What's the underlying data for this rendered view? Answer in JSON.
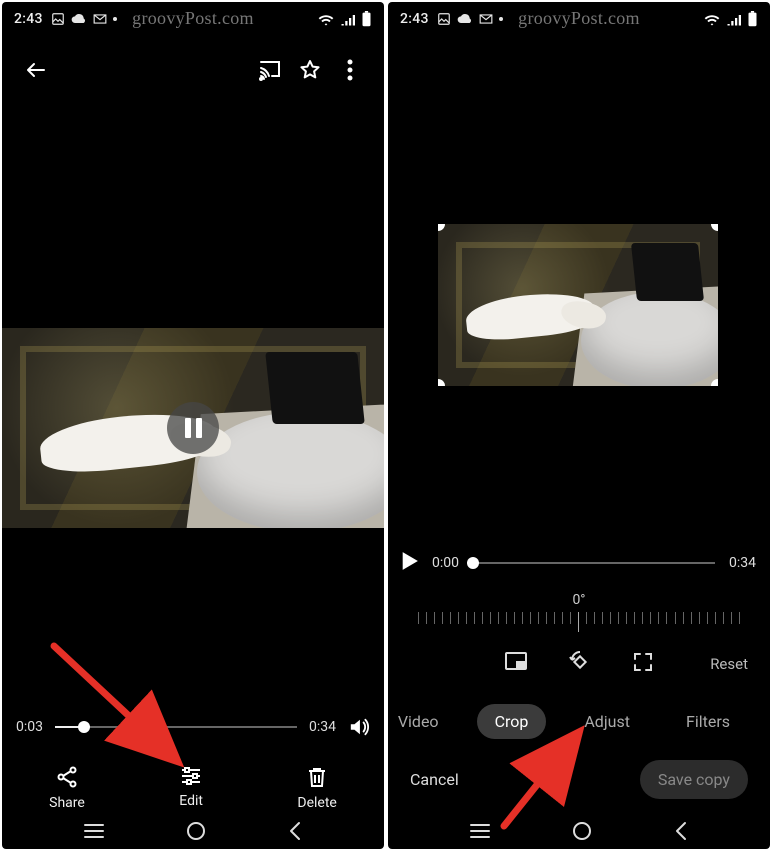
{
  "left": {
    "statusbar": {
      "time": "2:43"
    },
    "watermark": "groovyPost.com",
    "scrubber": {
      "current": "0:03",
      "total": "0:34",
      "progress_pct": 12
    },
    "actions": {
      "share": "Share",
      "edit": "Edit",
      "delete": "Delete"
    }
  },
  "right": {
    "statusbar": {
      "time": "2:43"
    },
    "watermark": "groovyPost.com",
    "scrubber": {
      "current": "0:00",
      "total": "0:34",
      "progress_pct": 0
    },
    "rotation_label": "0°",
    "tools": {
      "reset": "Reset"
    },
    "tabs": {
      "video": "Video",
      "crop": "Crop",
      "adjust": "Adjust",
      "filters": "Filters"
    },
    "footer": {
      "cancel": "Cancel",
      "save": "Save copy"
    }
  }
}
